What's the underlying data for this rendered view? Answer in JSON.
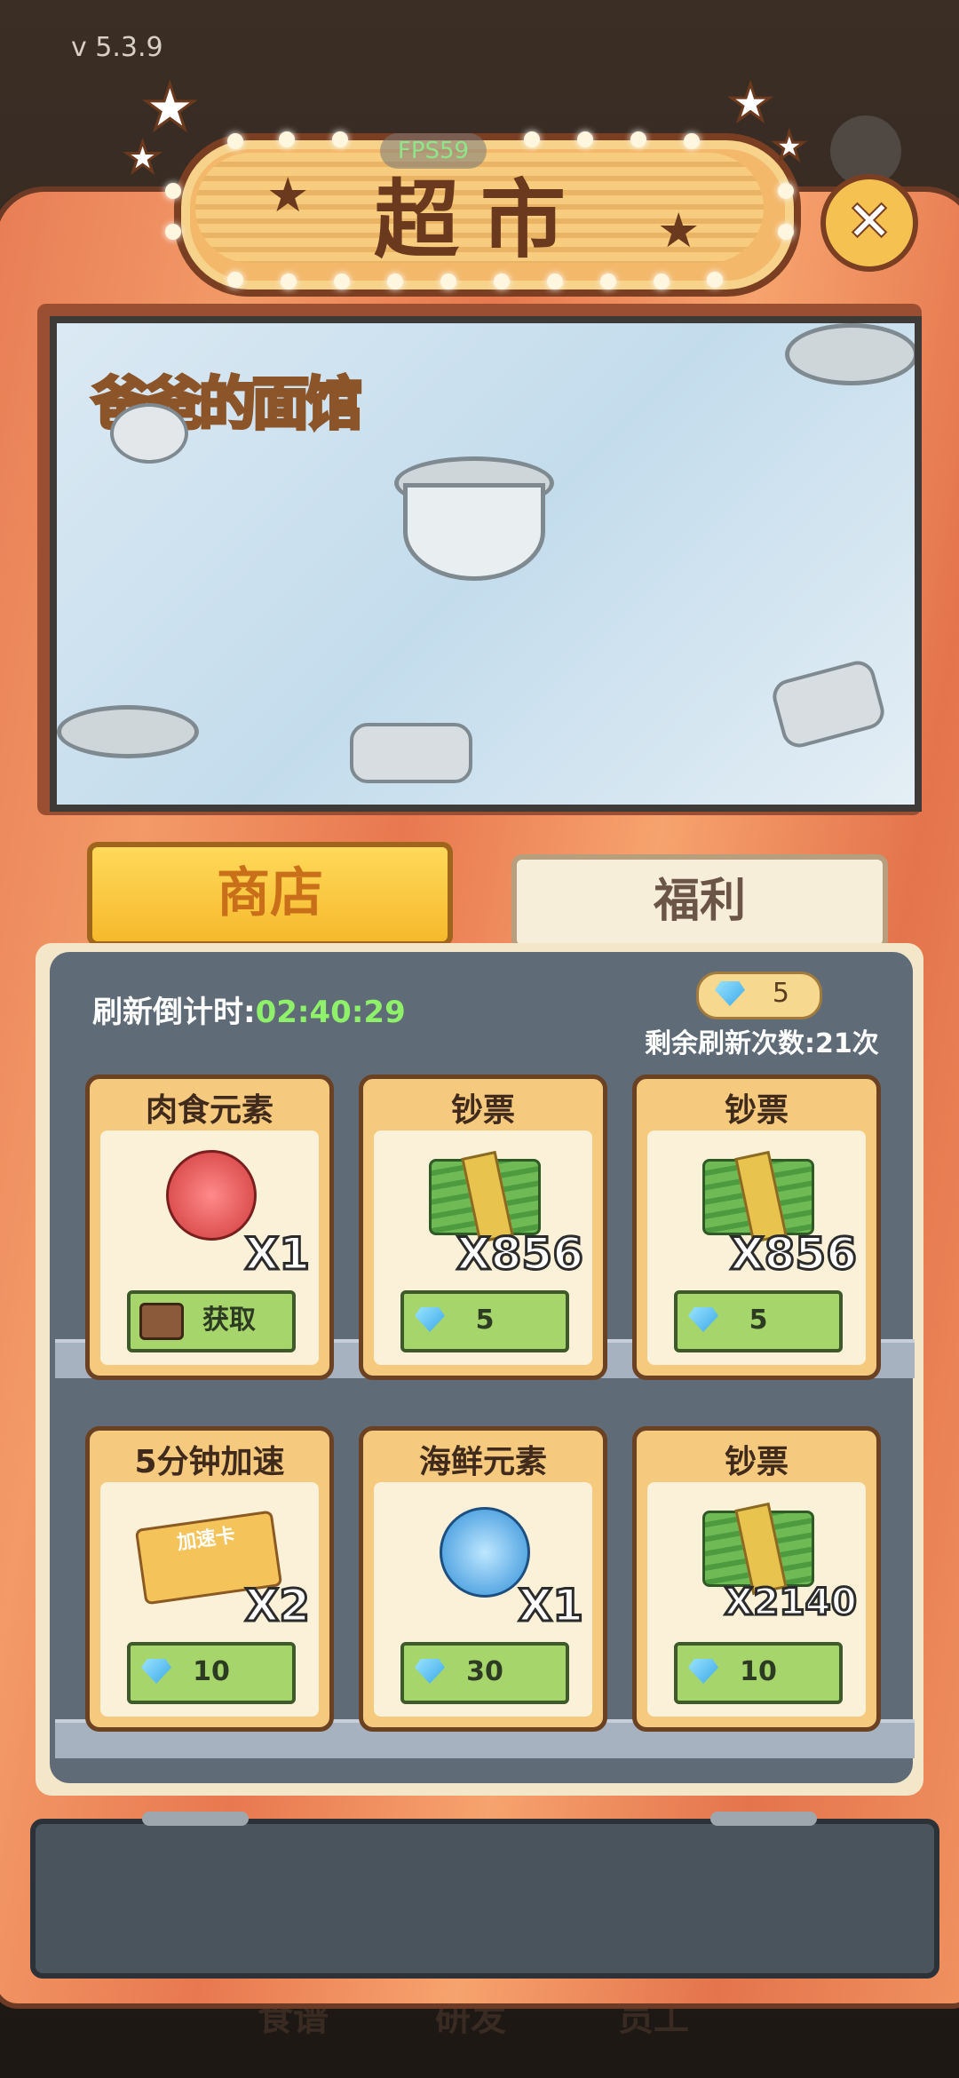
{
  "version": "v 5.3.9",
  "fps": "FPS59",
  "title": "超市",
  "close_icon": "×",
  "banner_logo": "爸爸的面馆",
  "tabs": [
    {
      "label": "商店",
      "selected": true
    },
    {
      "label": "福利",
      "selected": false
    }
  ],
  "refresh": {
    "label": "刷新倒计时:",
    "time": "02:40:29",
    "gem_count": "5",
    "remaining": "剩余刷新次数:21次"
  },
  "items": [
    {
      "name": "肉食元素",
      "qty": "X1",
      "button": "获取",
      "button_type": "video",
      "icon": "meat-element-icon"
    },
    {
      "name": "钞票",
      "qty": "X856",
      "button": "5",
      "button_type": "gem",
      "icon": "cash-stack-icon"
    },
    {
      "name": "钞票",
      "qty": "X856",
      "button": "5",
      "button_type": "gem",
      "icon": "cash-stack-icon"
    },
    {
      "name": "5分钟加速",
      "qty": "X2",
      "button": "10",
      "button_type": "gem",
      "icon": "speedup-card-icon",
      "card_text": "加速卡"
    },
    {
      "name": "海鲜元素",
      "qty": "X1",
      "button": "30",
      "button_type": "gem",
      "icon": "seafood-element-icon"
    },
    {
      "name": "钞票",
      "qty": "X2140",
      "button": "10",
      "button_type": "gem",
      "icon": "cash-stack-icon"
    }
  ],
  "bottom_nav": [
    "食谱",
    "研发",
    "员工"
  ],
  "colors": {
    "accent": "#f6b92c",
    "timer": "#8ff06a",
    "button": "#a6d56b"
  }
}
